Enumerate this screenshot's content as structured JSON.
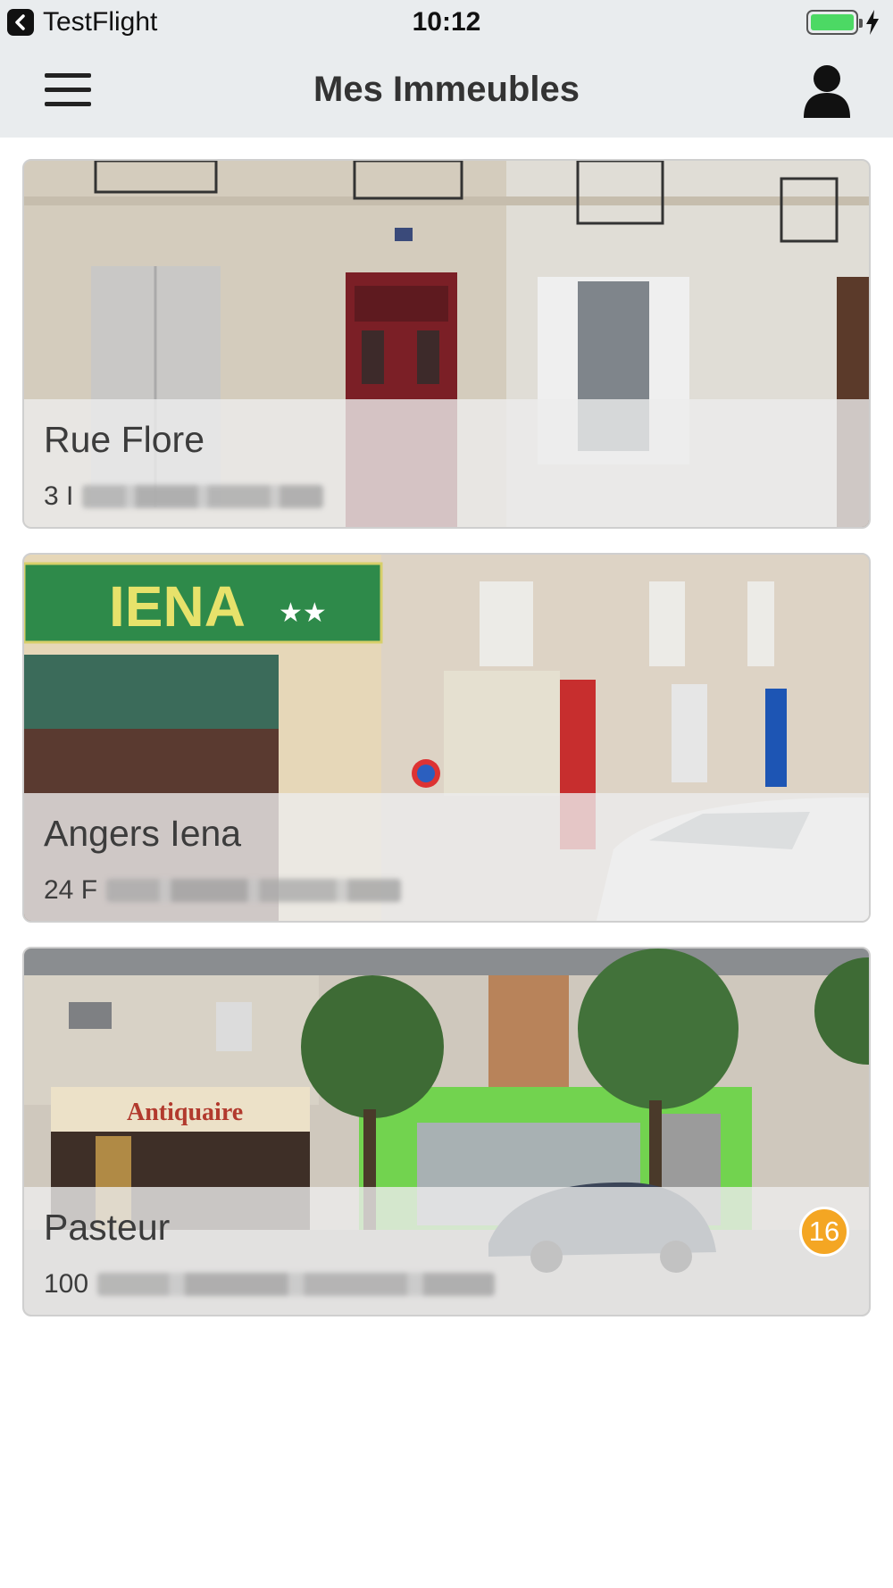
{
  "status_bar": {
    "back_app": "TestFlight",
    "time": "10:12",
    "battery_icon": "battery-charging-icon"
  },
  "header": {
    "title": "Mes Immeubles",
    "menu_icon": "hamburger-menu-icon",
    "user_icon": "user-icon"
  },
  "buildings": [
    {
      "name": "Rue Flore",
      "address_visible": "3 I",
      "address_blurred": true
    },
    {
      "name": "Angers Iena",
      "address_visible": "24 F",
      "address_blurred": true
    },
    {
      "name": "Pasteur",
      "address_visible": "100",
      "address_blurred": true,
      "badge": "16"
    }
  ],
  "colors": {
    "header_bg": "#e9ecee",
    "badge": "#f4a623",
    "battery": "#4cd964"
  }
}
